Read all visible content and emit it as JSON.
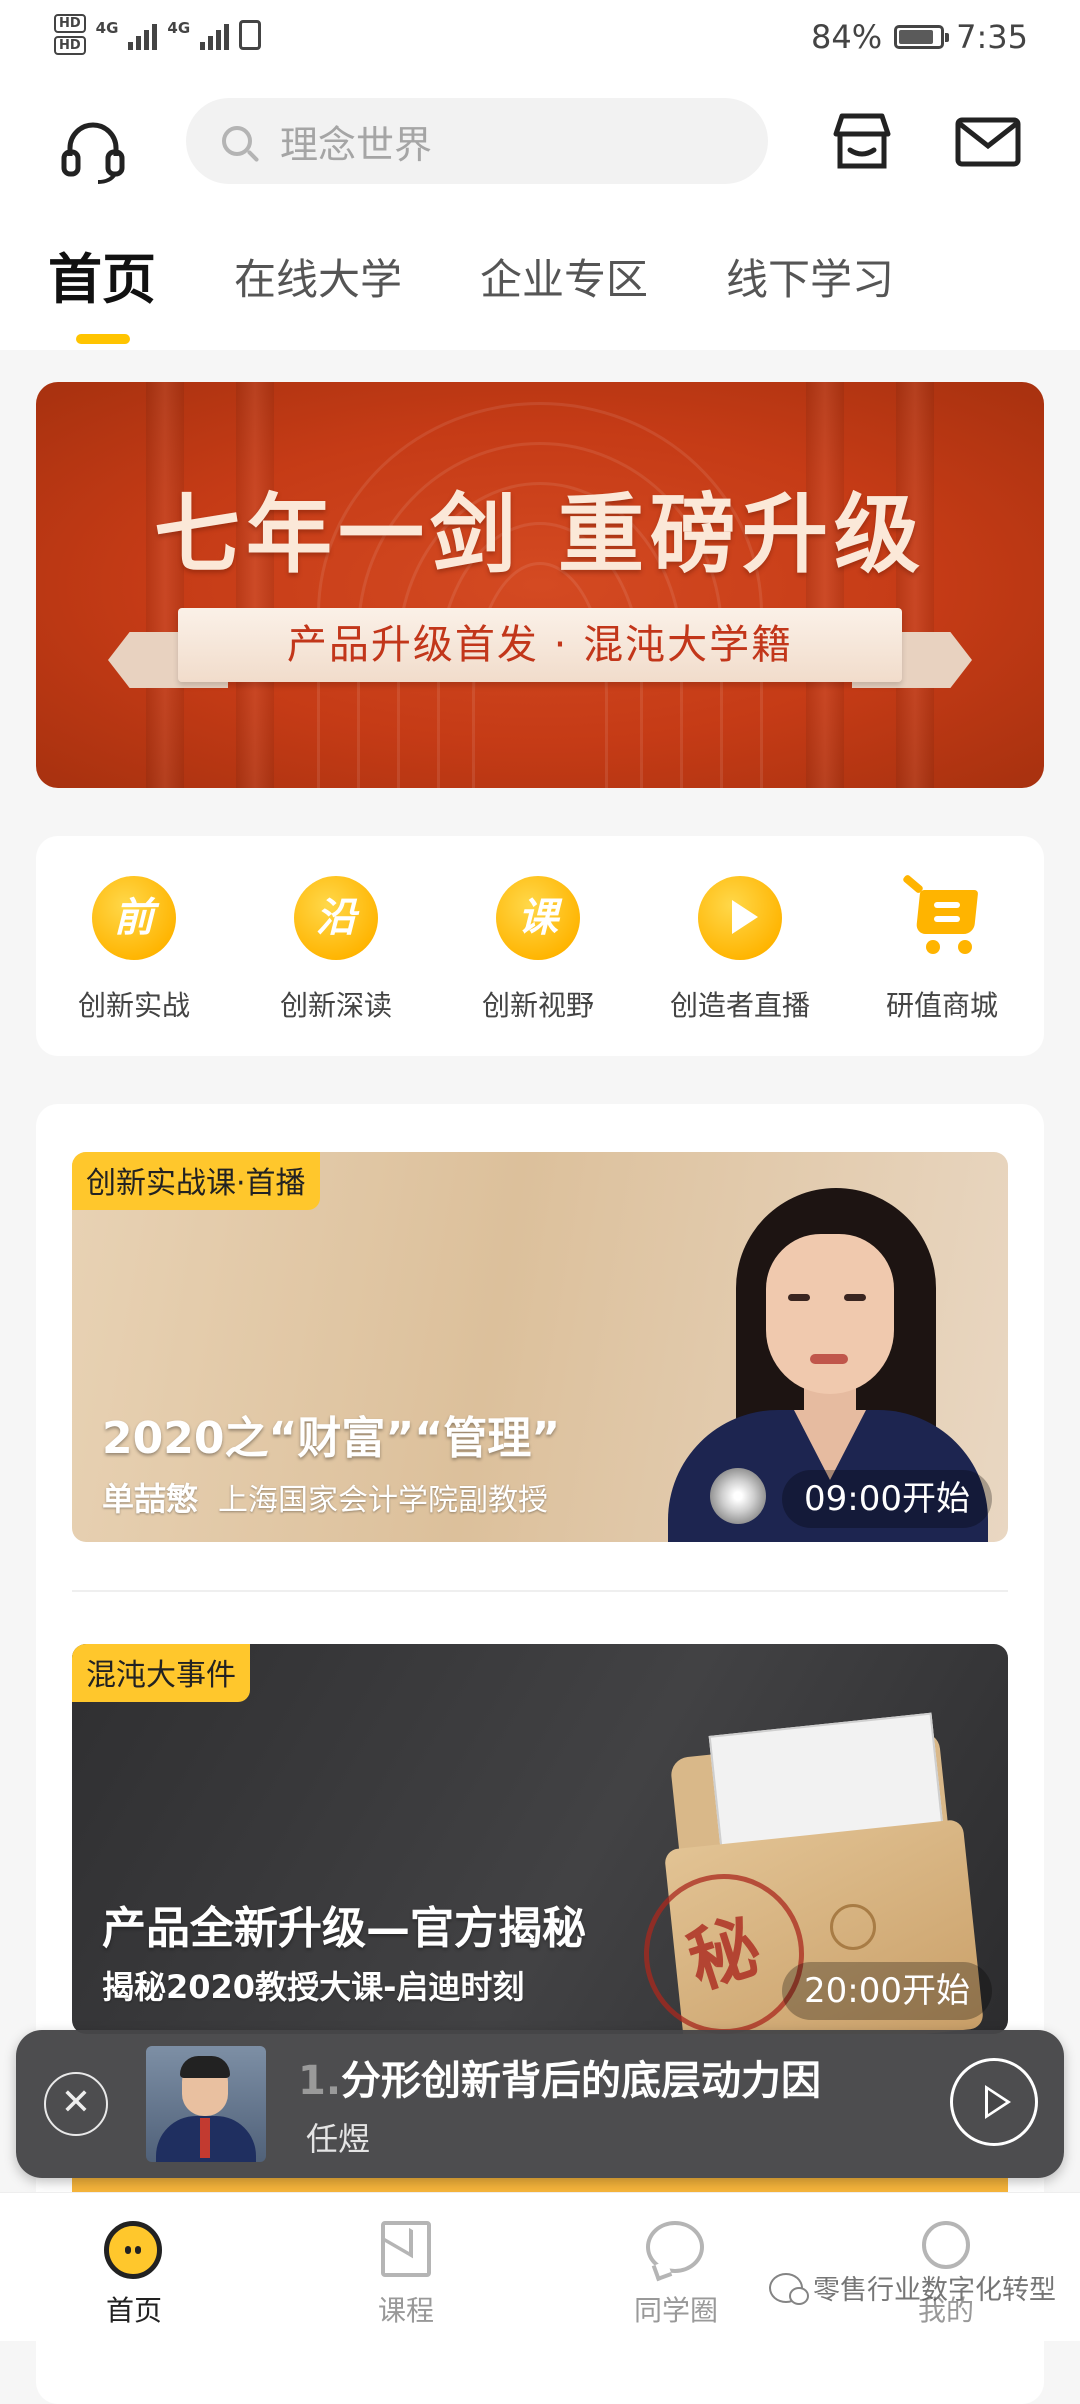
{
  "status_bar": {
    "hd1": "HD",
    "hd2": "HD",
    "net1": "4G",
    "net2": "4G",
    "battery": "84%",
    "time": "7:35"
  },
  "header": {
    "search_placeholder": "理念世界",
    "icons": [
      "headset-icon",
      "store-icon",
      "mail-icon"
    ]
  },
  "tabs": [
    {
      "label": "首页",
      "active": true
    },
    {
      "label": "在线大学",
      "active": false
    },
    {
      "label": "企业专区",
      "active": false
    },
    {
      "label": "线下学习",
      "active": false
    }
  ],
  "banner": {
    "title": "七年一剑  重磅升级",
    "subtitle": "产品升级首发 · 混沌大学籍"
  },
  "categories": [
    {
      "label": "创新实战",
      "glyph": "前",
      "icon": "qian-badge-icon"
    },
    {
      "label": "创新深读",
      "glyph": "沿",
      "icon": "yan-badge-icon"
    },
    {
      "label": "创新视野",
      "glyph": "课",
      "icon": "ke-badge-icon"
    },
    {
      "label": "创造者直播",
      "icon": "play-circle-icon"
    },
    {
      "label": "研值商城",
      "icon": "cart-icon"
    }
  ],
  "courses": [
    {
      "tag": "创新实战课·首播",
      "title": "2020之“财富”“管理”",
      "speaker": "单喆慜",
      "speaker_title": "上海国家会计学院副教授",
      "time": "09:00开始"
    },
    {
      "tag": "混沌大事件",
      "title": "产品全新升级—官方揭秘",
      "subtitle": "揭秘2020教授大课-启迪时刻",
      "stamp": "秘",
      "time": "20:00开始"
    }
  ],
  "player": {
    "title_prefix": "1.",
    "title": "分形创新背后的底层动力因",
    "author": "任煜"
  },
  "bottom_nav": [
    {
      "label": "首页",
      "active": true
    },
    {
      "label": "课程",
      "active": false
    },
    {
      "label": "同学圈",
      "active": false
    },
    {
      "label": "我的",
      "active": false
    }
  ],
  "watermark": "零售行业数字化转型",
  "colors": {
    "accent": "#ffc400",
    "banner_red": "#c53b16",
    "tag_yellow": "#ffc72c"
  }
}
